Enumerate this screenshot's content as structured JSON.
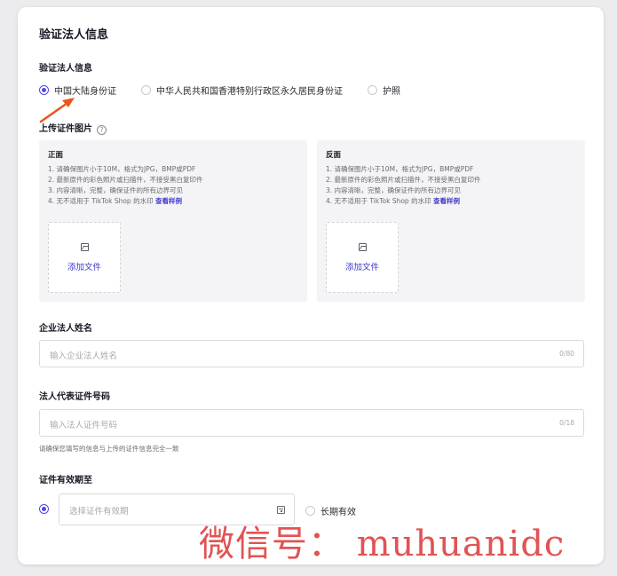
{
  "card": {
    "title": "验证法人信息"
  },
  "id_type": {
    "label": "验证法人信息",
    "options": [
      {
        "label": "中国大陆身份证",
        "checked": true
      },
      {
        "label": "中华人民共和国香港特别行政区永久居民身份证",
        "checked": false
      },
      {
        "label": "护照",
        "checked": false
      }
    ]
  },
  "upload": {
    "label": "上传证件图片",
    "help_icon": "?",
    "front": {
      "title": "正面",
      "rules": [
        "1. 请确保图片小于10M，格式为JPG，BMP或PDF",
        "2. 最新原件的彩色照片或扫描件，不接受黑白复印件",
        "3. 内容清晰，完整，确保证件的所有边界可见"
      ],
      "rule4_prefix": "4. 无不适用于 TikTok Shop 的水印",
      "sample_link": "查看样例",
      "add_file": "添加文件"
    },
    "back": {
      "title": "反面",
      "rules": [
        "1. 请确保图片小于10M，格式为JPG，BMP或PDF",
        "2. 最新原件的彩色照片或扫描件，不接受黑白复印件",
        "3. 内容清晰，完整，确保证件的所有边界可见"
      ],
      "rule4_prefix": "4. 无不适用于 TikTok Shop 的水印",
      "sample_link": "查看样例",
      "add_file": "添加文件"
    }
  },
  "legal_name": {
    "label": "企业法人姓名",
    "placeholder": "输入企业法人姓名",
    "counter": "0/80"
  },
  "id_number": {
    "label": "法人代表证件号码",
    "placeholder": "输入法人证件号码",
    "counter": "0/18",
    "hint": "请确保您填写的信息与上传的证件信息完全一致"
  },
  "expiry": {
    "label": "证件有效期至",
    "date_placeholder": "选择证件有效期",
    "date_selected": true,
    "long_term_label": "长期有效",
    "long_term_selected": false
  },
  "watermark": {
    "text": "微信号： muhuanidc"
  },
  "colors": {
    "accent": "#5348e3",
    "link": "#3f3ac9",
    "annotation_arrow": "#e8561e",
    "watermark": "#e04545"
  }
}
